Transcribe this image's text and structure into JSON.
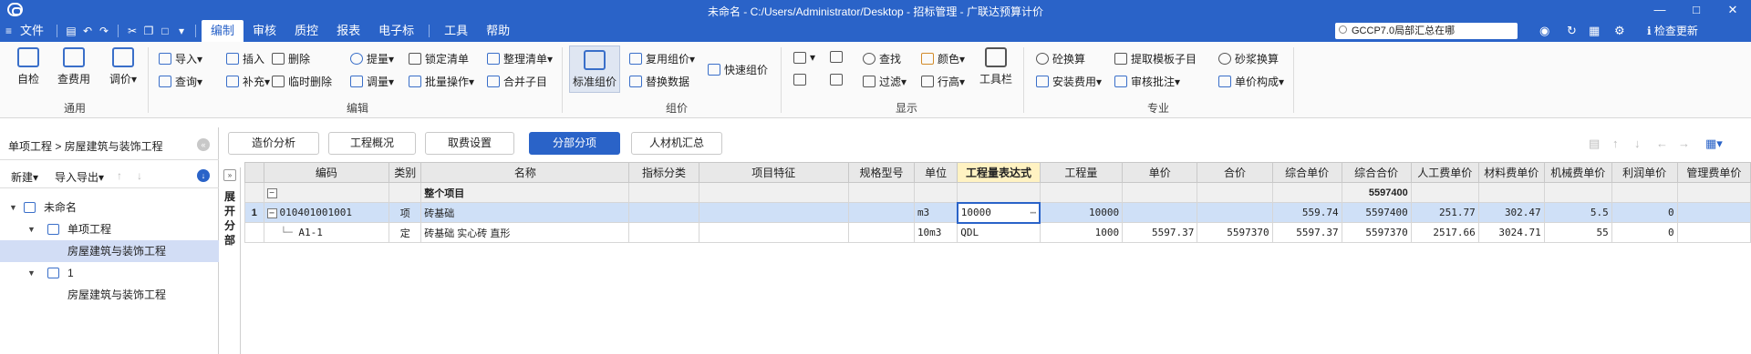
{
  "window": {
    "title": "未命名 - C:/Users/Administrator/Desktop - 招标管理 - 广联达预算计价"
  },
  "menu": {
    "file": "文件",
    "items": [
      "编制",
      "审核",
      "质控",
      "报表",
      "电子标",
      "工具",
      "帮助"
    ],
    "active": "编制"
  },
  "search": {
    "value": "GCCP7.0局部汇总在哪"
  },
  "topright": {
    "update": "检查更新"
  },
  "ribbon": {
    "groups": {
      "general": "通用",
      "edit": "编辑",
      "pricing": "组价",
      "display": "显示",
      "special": "专业"
    },
    "general": {
      "self_check": "自检",
      "fee_check": "查费用",
      "price_adjust": "调价"
    },
    "edit": {
      "import": "导入",
      "query": "查询",
      "insert": "插入",
      "supplement": "补充",
      "delete": "删除",
      "temp_delete": "临时删除",
      "extract_qty": "提量",
      "adjust_qty": "调量",
      "lock_list": "锁定清单",
      "batch_op": "批量操作",
      "organize_list": "整理清单",
      "merge_sub": "合并子目"
    },
    "pricing": {
      "standard": "标准组价",
      "reuse": "复用组价",
      "replace_data": "替换数据",
      "quick": "快速组价"
    },
    "display": {
      "find": "查找",
      "filter": "过滤",
      "color": "颜色",
      "row_height": "行高",
      "toolbar": "工具栏"
    },
    "special": {
      "concrete_convert": "砼换算",
      "install_fee": "安装费用",
      "extract_template": "提取模板子目",
      "review_annot": "审核批注",
      "mortar_convert": "砂浆换算",
      "unit_compose": "单价构成"
    }
  },
  "left": {
    "breadcrumb": "单项工程 > 房屋建筑与装饰工程",
    "toolbar": {
      "new": "新建",
      "import_export": "导入导出"
    },
    "tree": [
      {
        "label": "未命名"
      },
      {
        "label": "单项工程"
      },
      {
        "label": "房屋建筑与装饰工程"
      },
      {
        "label": "1"
      },
      {
        "label": "房屋建筑与装饰工程"
      }
    ]
  },
  "tabs": [
    {
      "label": "造价分析"
    },
    {
      "label": "工程概况"
    },
    {
      "label": "取费设置"
    },
    {
      "label": "分部分项"
    },
    {
      "label": "人材机汇总"
    }
  ],
  "active_tab": "分部分项",
  "strip": {
    "label": "展开分部"
  },
  "grid": {
    "headers": [
      "",
      "编码",
      "类别",
      "名称",
      "指标分类",
      "项目特征",
      "规格型号",
      "单位",
      "工程量表达式",
      "工程量",
      "单价",
      "合价",
      "综合单价",
      "综合合价",
      "人工费单价",
      "材料费单价",
      "机械费单价",
      "利润单价",
      "管理费单价"
    ],
    "rows": [
      {
        "idx": "",
        "code": "",
        "type": "",
        "name": "整个项目",
        "idxcat": "",
        "feature": "",
        "spec": "",
        "unit": "",
        "expr": "",
        "qty": "",
        "price": "",
        "total": "",
        "comp_price": "",
        "comp_total": "5597400",
        "labor": "",
        "material": "",
        "machine": "",
        "profit": "",
        "mgmt": ""
      },
      {
        "idx": "1",
        "code": "010401001001",
        "type": "项",
        "name": "砖基础",
        "idxcat": "",
        "feature": "",
        "spec": "",
        "unit": "m3",
        "expr": "10000",
        "qty": "10000",
        "price": "",
        "total": "",
        "comp_price": "559.74",
        "comp_total": "5597400",
        "labor": "251.77",
        "material": "302.47",
        "machine": "5.5",
        "profit": "0",
        "mgmt": ""
      },
      {
        "idx": "",
        "code": "A1-1",
        "type": "定",
        "name": "砖基础 实心砖 直形",
        "idxcat": "",
        "feature": "",
        "spec": "",
        "unit": "10m3",
        "expr": "QDL",
        "qty": "1000",
        "price": "5597.37",
        "total": "5597370",
        "comp_price": "5597.37",
        "comp_total": "5597370",
        "labor": "2517.66",
        "material": "3024.71",
        "machine": "55",
        "profit": "0",
        "mgmt": ""
      }
    ]
  },
  "colors": {
    "accent": "#2a63c8",
    "selected_row": "#cfe0f7",
    "header": "#e8e8e8"
  }
}
